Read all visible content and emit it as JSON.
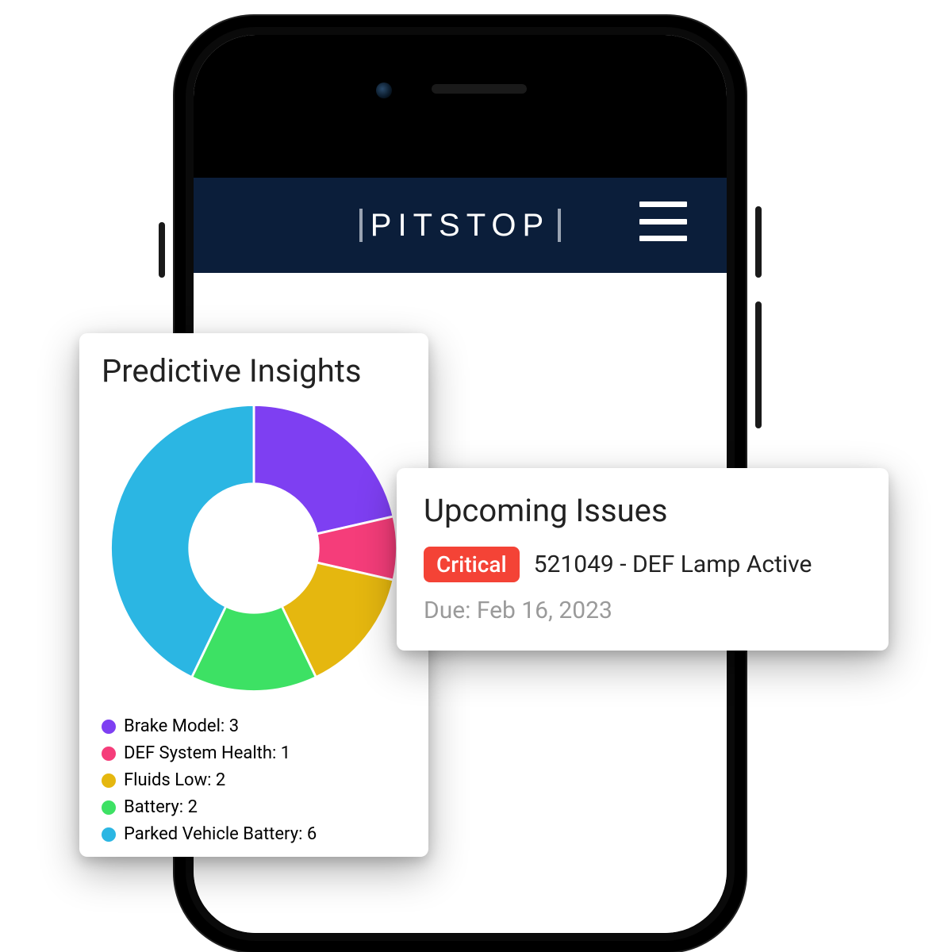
{
  "header": {
    "brand": "PITSTOP"
  },
  "insights": {
    "title": "Predictive Insights",
    "legend": [
      {
        "label": "Brake Model: 3",
        "color": "#7e3ff2"
      },
      {
        "label": "DEF System Health: 1",
        "color": "#f53d7a"
      },
      {
        "label": "Fluids Low: 2",
        "color": "#e5b70f"
      },
      {
        "label": "Battery: 2",
        "color": "#3de164"
      },
      {
        "label": "Parked Vehicle Battery: 6",
        "color": "#2bb6e3"
      }
    ]
  },
  "issues": {
    "title": "Upcoming Issues",
    "badge": "Critical",
    "text": "521049 - DEF Lamp Active",
    "due": "Due: Feb 16, 2023"
  },
  "chart_data": {
    "type": "pie",
    "title": "Predictive Insights",
    "series": [
      {
        "name": "Brake Model",
        "value": 3,
        "color": "#7e3ff2"
      },
      {
        "name": "DEF System Health",
        "value": 1,
        "color": "#f53d7a"
      },
      {
        "name": "Fluids Low",
        "value": 2,
        "color": "#e5b70f"
      },
      {
        "name": "Battery",
        "value": 2,
        "color": "#3de164"
      },
      {
        "name": "Parked Vehicle Battery",
        "value": 6,
        "color": "#2bb6e3"
      }
    ],
    "donut_inner_ratio": 0.45
  }
}
